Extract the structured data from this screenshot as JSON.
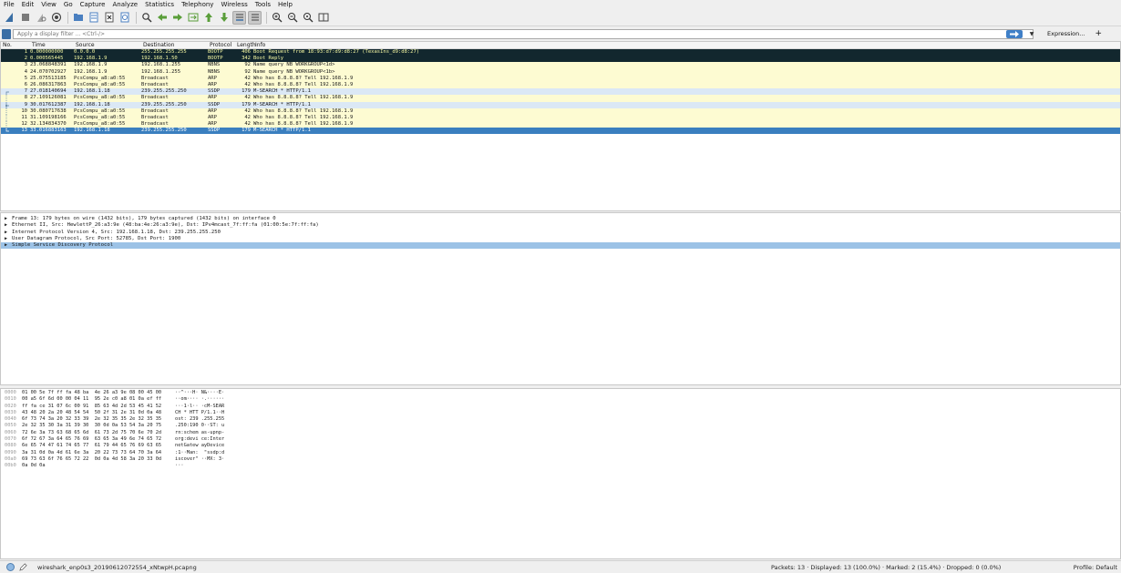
{
  "menu": [
    "File",
    "Edit",
    "View",
    "Go",
    "Capture",
    "Analyze",
    "Statistics",
    "Telephony",
    "Wireless",
    "Tools",
    "Help"
  ],
  "filter": {
    "placeholder": "Apply a display filter ... <Ctrl-/>",
    "expression_label": "Expression...",
    "plus_label": "+"
  },
  "columns": [
    "No.",
    "Time",
    "Source",
    "Destination",
    "Protocol",
    "Length",
    "Info"
  ],
  "colors": {
    "row_dark_bg": "#12272e",
    "row_dark_fg": "#f7f9a3",
    "row_yellow": "#fdfbd2",
    "row_blue": "#dbe8f5",
    "row_selected": "#3a7fbf",
    "accent": "#3f7fc7"
  },
  "packets": [
    {
      "no": "1",
      "time": "0.000000000",
      "src": "0.0.0.0",
      "dst": "255.255.255.255",
      "proto": "BOOTP",
      "len": "406",
      "info": "Boot Request from 18:93:d7:d9:d8:27 (TexasIns_d9:d8:27)",
      "style": "dark"
    },
    {
      "no": "2",
      "time": "0.000565445",
      "src": "192.168.1.9",
      "dst": "192.168.1.50",
      "proto": "BOOTP",
      "len": "342",
      "info": "Boot Reply",
      "style": "dark"
    },
    {
      "no": "3",
      "time": "23.068848391",
      "src": "192.168.1.9",
      "dst": "192.168.1.255",
      "proto": "NBNS",
      "len": "92",
      "info": "Name query NB WORKGROUP<1d>",
      "style": "yellow"
    },
    {
      "no": "4",
      "time": "24.070702927",
      "src": "192.168.1.9",
      "dst": "192.168.1.255",
      "proto": "NBNS",
      "len": "92",
      "info": "Name query NB WORKGROUP<1b>",
      "style": "yellow"
    },
    {
      "no": "5",
      "time": "25.075513185",
      "src": "PcsCompu_a8:a0:55",
      "dst": "Broadcast",
      "proto": "ARP",
      "len": "42",
      "info": "Who has 8.8.8.8? Tell 192.168.1.9",
      "style": "yellow"
    },
    {
      "no": "6",
      "time": "26.086317863",
      "src": "PcsCompu_a8:a0:55",
      "dst": "Broadcast",
      "proto": "ARP",
      "len": "42",
      "info": "Who has 8.8.8.8? Tell 192.168.1.9",
      "style": "yellow"
    },
    {
      "no": "7",
      "time": "27.018140694",
      "src": "192.168.1.18",
      "dst": "239.255.255.250",
      "proto": "SSDP",
      "len": "179",
      "info": "M-SEARCH * HTTP/1.1",
      "style": "blue"
    },
    {
      "no": "8",
      "time": "27.109126081",
      "src": "PcsCompu_a8:a0:55",
      "dst": "Broadcast",
      "proto": "ARP",
      "len": "42",
      "info": "Who has 8.8.8.8? Tell 192.168.1.9",
      "style": "yellow"
    },
    {
      "no": "9",
      "time": "30.017612387",
      "src": "192.168.1.18",
      "dst": "239.255.255.250",
      "proto": "SSDP",
      "len": "179",
      "info": "M-SEARCH * HTTP/1.1",
      "style": "blue"
    },
    {
      "no": "10",
      "time": "30.080717638",
      "src": "PcsCompu_a8:a0:55",
      "dst": "Broadcast",
      "proto": "ARP",
      "len": "42",
      "info": "Who has 8.8.8.8? Tell 192.168.1.9",
      "style": "yellow"
    },
    {
      "no": "11",
      "time": "31.109198166",
      "src": "PcsCompu_a8:a0:55",
      "dst": "Broadcast",
      "proto": "ARP",
      "len": "42",
      "info": "Who has 8.8.8.8? Tell 192.168.1.9",
      "style": "yellow"
    },
    {
      "no": "12",
      "time": "32.134834370",
      "src": "PcsCompu_a8:a0:55",
      "dst": "Broadcast",
      "proto": "ARP",
      "len": "42",
      "info": "Who has 8.8.8.8? Tell 192.168.1.9",
      "style": "yellow"
    },
    {
      "no": "13",
      "time": "33.016883163",
      "src": "192.168.1.18",
      "dst": "239.255.255.250",
      "proto": "SSDP",
      "len": "179",
      "info": "M-SEARCH * HTTP/1.1",
      "style": "selected"
    }
  ],
  "details": [
    {
      "text": "Frame 13: 179 bytes on wire (1432 bits), 179 bytes captured (1432 bits) on interface 0",
      "selected": false
    },
    {
      "text": "Ethernet II, Src: HewlettP_26:a3:9e (48:ba:4e:26:a3:9e), Dst: IPv4mcast_7f:ff:fa (01:00:5e:7f:ff:fa)",
      "selected": false
    },
    {
      "text": "Internet Protocol Version 4, Src: 192.168.1.18, Dst: 239.255.255.250",
      "selected": false
    },
    {
      "text": "User Datagram Protocol, Src Port: 52785, Dst Port: 1900",
      "selected": false
    },
    {
      "text": "Simple Service Discovery Protocol",
      "selected": true
    }
  ],
  "bytes": [
    {
      "off": "0000",
      "hex": "01 00 5e 7f ff fa 48 ba  4e 26 a3 9e 08 00 45 00",
      "ascii": "··^···H· N&····E·"
    },
    {
      "off": "0010",
      "hex": "00 a5 6f 6d 00 00 04 11  95 2e c0 a8 01 0a ef ff",
      "ascii": "··om···· ·.······"
    },
    {
      "off": "0020",
      "hex": "ff fa ce 31 07 6c 00 91  85 63 4d 2d 53 45 41 52",
      "ascii": "···1·l·· ·cM-SEAR"
    },
    {
      "off": "0030",
      "hex": "43 48 20 2a 20 48 54 54  50 2f 31 2e 31 0d 0a 48",
      "ascii": "CH * HTT P/1.1··H"
    },
    {
      "off": "0040",
      "hex": "6f 73 74 3a 20 32 33 39  2e 32 35 35 2e 32 35 35",
      "ascii": "ost: 239 .255.255"
    },
    {
      "off": "0050",
      "hex": "2e 32 35 30 3a 31 39 30  30 0d 0a 53 54 3a 20 75",
      "ascii": ".250:190 0··ST: u"
    },
    {
      "off": "0060",
      "hex": "72 6e 3a 73 63 68 65 6d  61 73 2d 75 70 6e 70 2d",
      "ascii": "rn:schem as-upnp-"
    },
    {
      "off": "0070",
      "hex": "6f 72 67 3a 64 65 76 69  63 65 3a 49 6e 74 65 72",
      "ascii": "org:devi ce:Inter"
    },
    {
      "off": "0080",
      "hex": "6e 65 74 47 61 74 65 77  61 79 44 65 76 69 63 65",
      "ascii": "netGatew ayDevice"
    },
    {
      "off": "0090",
      "hex": "3a 31 0d 0a 4d 61 6e 3a  20 22 73 73 64 70 3a 64",
      "ascii": ":1··Man:  \"ssdp:d"
    },
    {
      "off": "00a0",
      "hex": "69 73 63 6f 76 65 72 22  0d 0a 4d 58 3a 20 33 0d",
      "ascii": "iscover\" ··MX: 3·"
    },
    {
      "off": "00b0",
      "hex": "0a 0d 0a",
      "ascii": "···"
    }
  ],
  "status": {
    "filename": "wireshark_enp0s3_20190612072554_xNtwpH.pcapng",
    "stats": "Packets: 13 · Displayed: 13 (100.0%) · Marked: 2 (15.4%) · Dropped: 0 (0.0%)",
    "profile": "Profile: Default"
  }
}
